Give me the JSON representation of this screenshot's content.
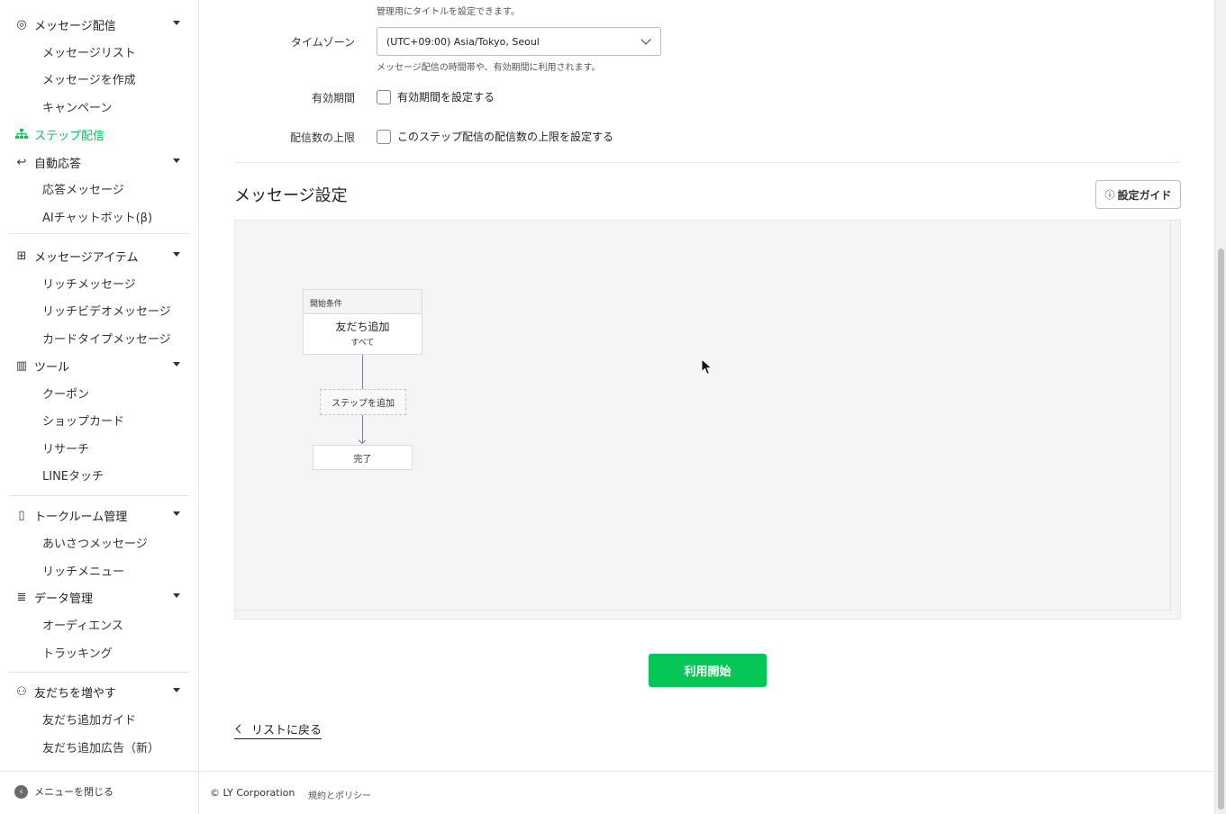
{
  "sidebar": {
    "groups": {
      "message": "メッセージ配信",
      "step": "ステップ配信",
      "auto": "自動応答",
      "items": "メッセージアイテム",
      "tools": "ツール",
      "talkroom": "トークルーム管理",
      "data": "データ管理",
      "friends": "友だちを増やす"
    },
    "items": {
      "message_list": "メッセージリスト",
      "create_message": "メッセージを作成",
      "campaign": "キャンペーン",
      "reply_message": "応答メッセージ",
      "ai_chatbot": "AIチャットボット(β)",
      "rich_message": "リッチメッセージ",
      "rich_video": "リッチビデオメッセージ",
      "card_type": "カードタイプメッセージ",
      "coupon": "クーポン",
      "shop_card": "ショップカード",
      "research": "リサーチ",
      "line_touch": "LINEタッチ",
      "greeting": "あいさつメッセージ",
      "rich_menu": "リッチメニュー",
      "audience": "オーディエンス",
      "tracking": "トラッキング",
      "friend_guide": "友だち追加ガイド",
      "friend_ads": "友だち追加広告（新）"
    },
    "close_menu": "メニューを閉じる",
    "accent_color": "#06c755"
  },
  "form": {
    "title_hint": "管理用にタイトルを設定できます。",
    "timezone_label": "タイムゾーン",
    "timezone_value": "(UTC+09:00) Asia/Tokyo, Seoul",
    "timezone_hint": "メッセージ配信の時間帯や、有効期間に利用されます。",
    "validity_label": "有効期間",
    "validity_checkbox": "有効期間を設定する",
    "limit_label": "配信数の上限",
    "limit_checkbox": "このステップ配信の配信数の上限を設定する"
  },
  "message_settings": {
    "title": "メッセージ設定",
    "guide_button": "設定ガイド",
    "flow": {
      "start_header": "開始条件",
      "start_title": "友だち追加",
      "start_sub": "すべて",
      "add_step": "ステップを追加",
      "done": "完了"
    }
  },
  "actions": {
    "start_button": "利用開始",
    "back_link": "リストに戻る"
  },
  "footer": {
    "copyright": "© LY Corporation",
    "policy": "規約とポリシー"
  }
}
